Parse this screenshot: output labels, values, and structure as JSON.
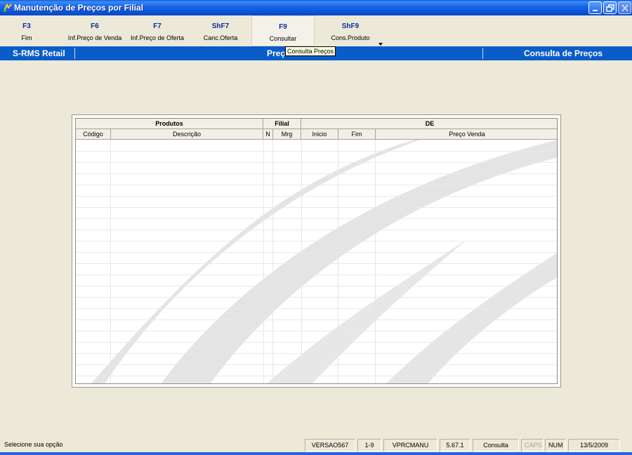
{
  "window": {
    "title": "Manutenção de Preços por Filial"
  },
  "toolbar": [
    {
      "key": "F3",
      "label": "Fim"
    },
    {
      "key": "F6",
      "label": "Inf.Preço de Venda"
    },
    {
      "key": "F7",
      "label": "Inf.Preço de Oferta"
    },
    {
      "key": "ShF7",
      "label": "Canc.Oferta"
    },
    {
      "key": "F9",
      "label": "Consultar"
    },
    {
      "key": "ShF9",
      "label": "Cons.Produto"
    }
  ],
  "header": {
    "left": "S-RMS Retail",
    "center": "Preço",
    "right": "Consulta de Preços"
  },
  "tooltip": "Consulta Preços",
  "grid": {
    "groups": [
      "Produtos",
      "Filial",
      "DE"
    ],
    "columns": [
      "Código",
      "Descrição",
      "N",
      "Mrg",
      "Inicio",
      "Fim",
      "Preço Venda"
    ],
    "rows": []
  },
  "status": {
    "message": "Selecione sua opção",
    "version": "VERSAO567",
    "page": "1-9",
    "program": "VPRCMANU",
    "build": "5.67.1",
    "mode": "Consulta",
    "caps": "CAPS",
    "num": "NUM",
    "date": "13/5/2009"
  },
  "colors": {
    "titlebar": "#0a52d6",
    "header": "#0a5cc8",
    "accent_key": "#0b2c9b",
    "background": "#ece9d8"
  }
}
